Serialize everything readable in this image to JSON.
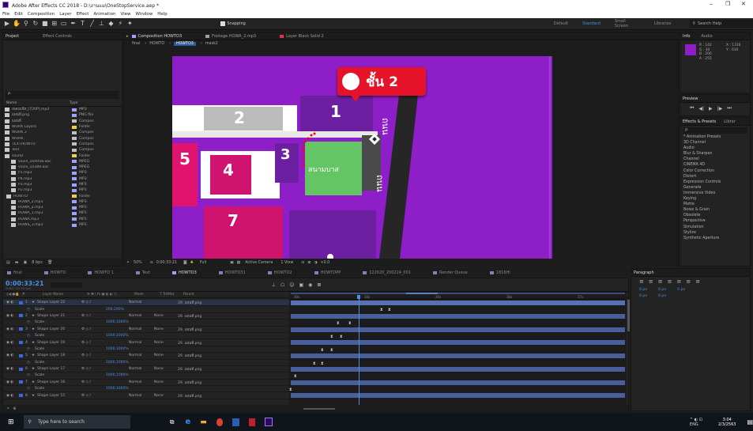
{
  "window": {
    "title": "Adobe After Effects CC 2018 - D:\\งานแม\\OneStopService.aep *"
  },
  "menu": [
    "File",
    "Edit",
    "Composition",
    "Layer",
    "Effect",
    "Animation",
    "View",
    "Window",
    "Help"
  ],
  "toolbar": {
    "snapping": "Snapping",
    "workspaces": [
      "Default",
      "Standard",
      "Small Screen",
      "Libraries"
    ],
    "search": "Search Help"
  },
  "project": {
    "tab": "Project",
    "effect_tab": "Effect Controls",
    "search_placeholder": "ρ.",
    "col_name": "Name",
    "col_type": "Type",
    "items": [
      {
        "name": "เพลงแจ๊ส_[720P].mp3",
        "type": "MP3",
        "color": "#a0a0ff"
      },
      {
        "name": "แผนที่.png",
        "type": "PNG file",
        "color": "#a0a0ff"
      },
      {
        "name": "แผนที่",
        "type": "Compos",
        "color": "#c0c0c0"
      },
      {
        "name": "WORK Layers",
        "type": "Folder",
        "color": "#f4d03f"
      },
      {
        "name": "WORK 2",
        "type": "Compos",
        "color": "#c0c0c0"
      },
      {
        "name": "WORK",
        "type": "Compos",
        "color": "#c0c0c0"
      },
      {
        "name": "TEXTHOWTO",
        "type": "Compos",
        "color": "#c0c0c0"
      },
      {
        "name": "Text",
        "type": "Compos",
        "color": "#c0c0c0"
      },
      {
        "name": "sound",
        "type": "Folder",
        "color": "#f4d03f"
      },
      {
        "name": "voice_104058.aac",
        "type": "MPEG",
        "color": "#a0a0ff"
      },
      {
        "name": "voice_10389.aac",
        "type": "MPEG",
        "color": "#a0a0ff"
      },
      {
        "name": "P1.mp3",
        "type": "MP3",
        "color": "#a0a0ff"
      },
      {
        "name": "P4.mp3",
        "type": "MP3",
        "color": "#a0a0ff"
      },
      {
        "name": "P3.mp3",
        "type": "MP3",
        "color": "#a0a0ff"
      },
      {
        "name": "P2.mp3",
        "type": "MP3",
        "color": "#a0a0ff"
      },
      {
        "name": "HOWTO",
        "type": "Folder",
        "color": "#f4d03f"
      },
      {
        "name": "HOWA_2.mp3",
        "type": "MP3",
        "color": "#a0a0ff"
      },
      {
        "name": "HOWA_2.mp3",
        "type": "MP3",
        "color": "#a0a0ff"
      },
      {
        "name": "HOWA_1.mp3",
        "type": "MP3",
        "color": "#a0a0ff"
      },
      {
        "name": "HOWA.mp3",
        "type": "MP3",
        "color": "#a0a0ff"
      },
      {
        "name": "HOWS_3.mp3",
        "type": "MP3",
        "color": "#a0a0ff"
      }
    ],
    "bpc": "8 bpc"
  },
  "comp": {
    "tab": "Composition HOWTO3",
    "footage_tab": "Footage HOWA_2.mp3",
    "layer_tab": "Layer Black Solid 2",
    "breadcrumbs": [
      "final",
      "HOWTO",
      "HOWTO3",
      "mask2"
    ],
    "pin_label": "ชั้น 2",
    "room_labels": [
      "1",
      "2",
      "3",
      "4",
      "5",
      "7"
    ],
    "road_label": "ถนน",
    "court_label": "สนามบาส",
    "zoom": "50%",
    "timecode": "0:00:33:21",
    "quality": "Full",
    "camera": "Active Camera",
    "view": "1 View",
    "offset": "+0.0"
  },
  "info": {
    "tab": "Info",
    "audio_tab": "Audio",
    "r": "R : 142",
    "g": "G : 30",
    "b": "B : 200",
    "a": "A : 255",
    "x": "X : 1316",
    "y": "Y : 610"
  },
  "preview": {
    "tab": "Preview"
  },
  "effects": {
    "tab": "Effects & Presets",
    "lib_tab": "Librar",
    "search": "ρ.",
    "items": [
      "* Animation Presets",
      "3D Channel",
      "Audio",
      "Blur & Sharpen",
      "Channel",
      "CINEMA 4D",
      "Color Correction",
      "Distort",
      "Expression Controls",
      "Generate",
      "Immersive Video",
      "Keying",
      "Matte",
      "Noise & Grain",
      "Obsolete",
      "Perspective",
      "Simulation",
      "Stylize",
      "Synthetic Aperture"
    ]
  },
  "paragraph": {
    "tab": "Paragraph",
    "px1": "0 px",
    "px2": "0 px",
    "px3": "0 px",
    "px4": "0 px",
    "px5": "0 px"
  },
  "timeline": {
    "tabs": [
      "final",
      "HOWTO",
      "HOWTO 1",
      "Text",
      "HOWTO3",
      "HOWTO31",
      "HOWTO2",
      "HOWTOPP",
      "122020_200224_001",
      "Render Queue",
      "1816Hi"
    ],
    "active_tab": "HOWTO3",
    "timecode": "0:00:33:21",
    "timecode_sub": "00822 (25.00 fps)",
    "cols": {
      "layer_name": "Layer Name",
      "mode": "Mode",
      "trkmat": "T TrkMat",
      "parent": "Parent"
    },
    "ruler": [
      "30s",
      "34s",
      "35s",
      "36s",
      "37s"
    ],
    "layers": [
      {
        "num": "1",
        "name": "Shape Layer 22",
        "scale": "200,200%",
        "mode": "Normal",
        "trk": "",
        "parent": "29. แผนที่.png"
      },
      {
        "num": "2",
        "name": "Shape Layer 21",
        "scale": "1000,1000%",
        "mode": "Normal",
        "trk": "None",
        "parent": "29. แผนที่.png"
      },
      {
        "num": "3",
        "name": "Shape Layer 20",
        "scale": "1000,1000%",
        "mode": "Normal",
        "trk": "None",
        "parent": "29. แผนที่.png"
      },
      {
        "num": "4",
        "name": "Shape Layer 19",
        "scale": "1000,1000%",
        "mode": "Normal",
        "trk": "None",
        "parent": "29. แผนที่.png"
      },
      {
        "num": "5",
        "name": "Shape Layer 18",
        "scale": "1000,1000%",
        "mode": "Normal",
        "trk": "None",
        "parent": "29. แผนที่.png"
      },
      {
        "num": "6",
        "name": "Shape Layer 17",
        "scale": "1000,1000%",
        "mode": "Normal",
        "trk": "None",
        "parent": "29. แผนที่.png"
      },
      {
        "num": "7",
        "name": "Shape Layer 16",
        "scale": "1000,1000%",
        "mode": "Normal",
        "trk": "None",
        "parent": "29. แผนที่.png"
      },
      {
        "num": "8",
        "name": "Shape Layer 15",
        "scale": "",
        "mode": "Normal",
        "trk": "None",
        "parent": "29. แผนที่.png"
      }
    ],
    "scale_label": "Scale"
  },
  "taskbar": {
    "search": "Type here to search",
    "time": "3:04",
    "date": "2/3/2563"
  }
}
